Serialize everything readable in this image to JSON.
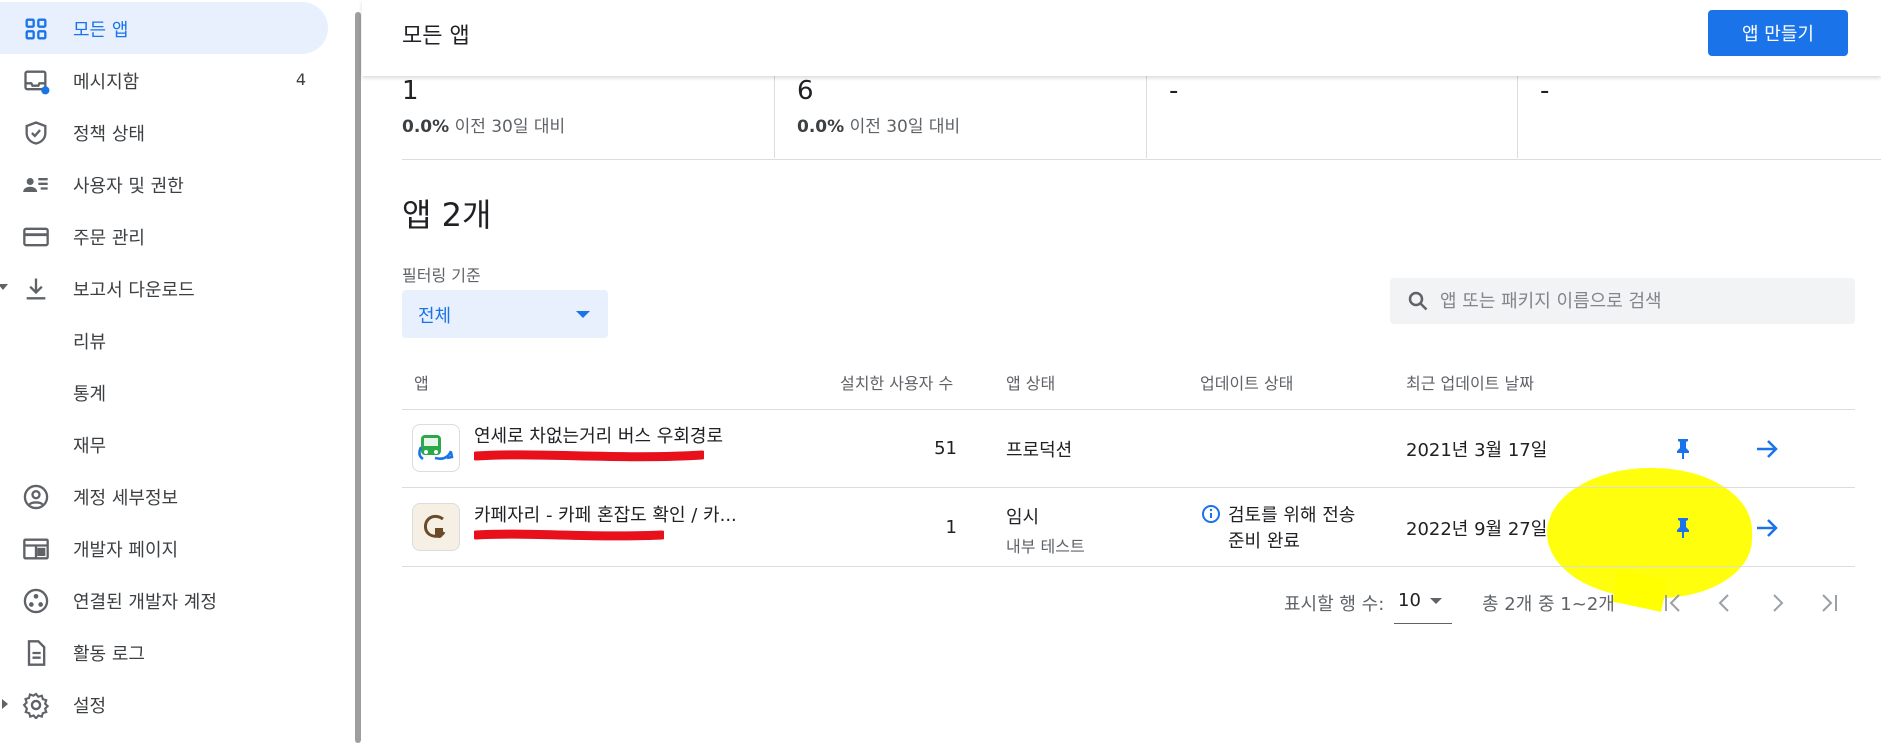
{
  "sidebar": {
    "items": [
      {
        "label": "모든 앱",
        "icon": "apps-grid-icon",
        "active": true
      },
      {
        "label": "메시지함",
        "icon": "inbox-icon",
        "count": "4"
      },
      {
        "label": "정책 상태",
        "icon": "shield-check-icon"
      },
      {
        "label": "사용자 및 권한",
        "icon": "people-list-icon"
      },
      {
        "label": "주문 관리",
        "icon": "credit-card-icon"
      },
      {
        "label": "보고서 다운로드",
        "icon": "download-icon",
        "expanded": true
      },
      {
        "label": "리뷰"
      },
      {
        "label": "통계"
      },
      {
        "label": "재무"
      },
      {
        "label": "계정 세부정보",
        "icon": "account-circle-icon"
      },
      {
        "label": "개발자 페이지",
        "icon": "web-page-icon"
      },
      {
        "label": "연결된 개발자 계정",
        "icon": "linked-accounts-icon"
      },
      {
        "label": "활동 로그",
        "icon": "document-icon"
      },
      {
        "label": "설정",
        "icon": "gear-icon",
        "collapsed": true
      }
    ]
  },
  "header": {
    "title": "모든 앱",
    "create_button": "앱 만들기"
  },
  "stats": [
    {
      "value": "1",
      "delta": "0.0%",
      "delta_text": "이전 30일 대비"
    },
    {
      "value": "6",
      "delta": "0.0%",
      "delta_text": "이전 30일 대비"
    },
    {
      "value": "-"
    },
    {
      "value": "-"
    }
  ],
  "section_title": "앱 2개",
  "filter": {
    "label": "필터링 기준",
    "value": "전체"
  },
  "search": {
    "placeholder": "앱 또는 패키지 이름으로 검색"
  },
  "table": {
    "headers": {
      "app": "앱",
      "installs": "설치한 사용자 수",
      "status": "앱 상태",
      "update_status": "업데이트 상태",
      "last_update": "최근 업데이트 날짜"
    },
    "rows": [
      {
        "name": "연세로 차없는거리 버스 우회경로",
        "installs": "51",
        "status": "프로덕션",
        "status_sub": "",
        "update_status": "",
        "last_update": "2021년 3월 17일"
      },
      {
        "name": "카페자리 - 카페 혼잡도 확인 / 카...",
        "installs": "1",
        "status": "임시",
        "status_sub": "내부 테스트",
        "update_status_line1": "검토를 위해 전송",
        "update_status_line2": "준비 완료",
        "last_update": "2022년 9월 27일"
      }
    ]
  },
  "pagination": {
    "rows_label": "표시할 행 수:",
    "rows_value": "10",
    "range": "총 2개 중 1~2개"
  },
  "colors": {
    "accent": "#1a73e8",
    "active_bg": "#e8f0fe",
    "highlight": "#ffff00",
    "redaction": "#e8101a"
  }
}
